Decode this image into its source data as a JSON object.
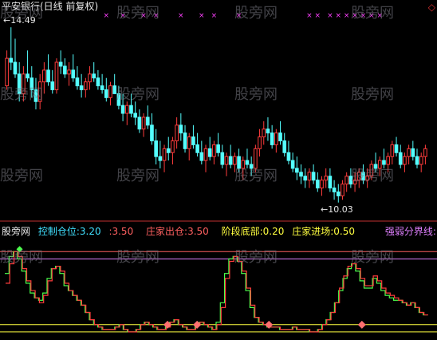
{
  "title": "平安银行(日线 前复权)",
  "watermark": "股旁网",
  "indicator_name": "股旁网",
  "colors": {
    "background": "#000000",
    "up_candle": "#ff3c3c",
    "down_candle": "#54ffff",
    "x_marker": "#ff40ff",
    "separator": "#c03030",
    "green_line": "#4cff4c",
    "red_line": "#ff3c3c",
    "yellow_line": "#ffff40",
    "purple_line": "#e080ff",
    "pink_diamond": "#ff7070"
  },
  "indicators": [
    {
      "label": "控制仓位:",
      "value": "3.20",
      "color": "#40e0ff"
    },
    {
      "label": ":",
      "value": "3.50",
      "color": "#ff6060"
    },
    {
      "label": "庄家出仓:",
      "value": "3.50",
      "color": "#ff6060"
    },
    {
      "label": "阶段底部:",
      "value": "0.20",
      "color": "#ffff40"
    },
    {
      "label": "庄家进场:",
      "value": "0.50",
      "color": "#ffff40"
    },
    {
      "label": "强弱分界线:",
      "value": "1.",
      "color": "#e080ff"
    }
  ],
  "chart_data": [
    {
      "type": "candlestick",
      "name": "price",
      "ylim": [
        9.7,
        14.9
      ],
      "annotations": [
        {
          "text": "14.49",
          "value": 14.49,
          "kind": "high"
        },
        {
          "text": "10.03",
          "value": 10.03,
          "kind": "low"
        }
      ],
      "x_markers": [
        24,
        28,
        33,
        36,
        42,
        47,
        50,
        56,
        73,
        75,
        78,
        80,
        82,
        84,
        86,
        88,
        90,
        108,
        126
      ],
      "candles": [
        [
          13.0,
          13.9,
          12.9,
          13.7
        ],
        [
          13.7,
          14.49,
          13.4,
          13.6
        ],
        [
          13.6,
          14.2,
          13.2,
          13.3
        ],
        [
          13.3,
          13.6,
          12.6,
          12.8
        ],
        [
          12.8,
          13.5,
          12.6,
          13.3
        ],
        [
          13.3,
          13.9,
          13.1,
          13.2
        ],
        [
          13.2,
          13.5,
          12.7,
          12.9
        ],
        [
          12.9,
          13.2,
          12.4,
          12.6
        ],
        [
          12.6,
          13.3,
          12.4,
          13.1
        ],
        [
          13.1,
          13.6,
          12.8,
          13.4
        ],
        [
          13.4,
          13.8,
          13.0,
          13.1
        ],
        [
          13.1,
          13.4,
          12.8,
          12.9
        ],
        [
          12.9,
          13.7,
          12.8,
          13.6
        ],
        [
          13.6,
          13.9,
          13.3,
          13.5
        ],
        [
          13.5,
          13.7,
          13.2,
          13.3
        ],
        [
          13.3,
          13.6,
          13.0,
          13.4
        ],
        [
          13.4,
          13.8,
          13.1,
          13.2
        ],
        [
          13.2,
          13.5,
          12.9,
          13.0
        ],
        [
          13.0,
          13.3,
          12.7,
          12.9
        ],
        [
          12.9,
          13.2,
          12.7,
          13.1
        ],
        [
          13.1,
          13.5,
          12.9,
          13.3
        ],
        [
          13.3,
          13.6,
          13.1,
          13.2
        ],
        [
          13.2,
          13.4,
          12.9,
          13.0
        ],
        [
          13.0,
          13.3,
          12.8,
          12.9
        ],
        [
          12.9,
          13.2,
          12.6,
          12.7
        ],
        [
          12.7,
          13.1,
          12.5,
          13.0
        ],
        [
          13.0,
          13.3,
          12.8,
          12.8
        ],
        [
          12.8,
          13.0,
          12.4,
          12.5
        ],
        [
          12.5,
          12.8,
          12.1,
          12.3
        ],
        [
          12.3,
          12.6,
          12.0,
          12.5
        ],
        [
          12.5,
          12.8,
          12.2,
          12.3
        ],
        [
          12.3,
          12.6,
          12.0,
          12.2
        ],
        [
          12.2,
          12.4,
          11.8,
          11.9
        ],
        [
          11.9,
          12.3,
          11.7,
          12.2
        ],
        [
          12.2,
          12.5,
          11.9,
          12.0
        ],
        [
          12.0,
          12.3,
          11.5,
          11.6
        ],
        [
          11.6,
          11.9,
          11.0,
          11.2
        ],
        [
          11.2,
          11.6,
          10.9,
          11.1
        ],
        [
          11.1,
          11.5,
          10.8,
          11.4
        ],
        [
          11.4,
          11.7,
          11.1,
          11.3
        ],
        [
          11.3,
          11.7,
          11.0,
          11.6
        ],
        [
          11.6,
          12.2,
          11.4,
          12.0
        ],
        [
          12.0,
          12.3,
          11.6,
          11.8
        ],
        [
          11.8,
          12.0,
          11.3,
          11.4
        ],
        [
          11.4,
          11.8,
          11.1,
          11.7
        ],
        [
          11.7,
          12.0,
          11.4,
          11.5
        ],
        [
          11.5,
          11.8,
          11.2,
          11.3
        ],
        [
          11.3,
          11.6,
          11.0,
          11.1
        ],
        [
          11.1,
          11.5,
          10.8,
          11.4
        ],
        [
          11.4,
          11.7,
          11.1,
          11.2
        ],
        [
          11.2,
          11.6,
          11.0,
          11.5
        ],
        [
          11.5,
          11.8,
          11.2,
          11.3
        ],
        [
          11.3,
          11.5,
          10.9,
          11.0
        ],
        [
          11.0,
          11.3,
          10.7,
          11.2
        ],
        [
          11.2,
          11.5,
          10.9,
          11.0
        ],
        [
          11.0,
          11.3,
          10.8,
          11.2
        ],
        [
          11.2,
          11.4,
          10.8,
          10.9
        ],
        [
          10.9,
          11.2,
          10.6,
          11.1
        ],
        [
          11.1,
          11.4,
          10.9,
          11.0
        ],
        [
          11.0,
          11.2,
          10.7,
          10.9
        ],
        [
          10.9,
          11.5,
          10.8,
          11.4
        ],
        [
          11.4,
          11.9,
          11.2,
          11.7
        ],
        [
          11.7,
          12.1,
          11.5,
          11.9
        ],
        [
          11.9,
          12.2,
          11.6,
          11.8
        ],
        [
          11.8,
          12.0,
          11.4,
          11.5
        ],
        [
          11.5,
          11.9,
          11.3,
          11.8
        ],
        [
          11.8,
          12.1,
          11.5,
          11.6
        ],
        [
          11.6,
          11.8,
          11.2,
          11.3
        ],
        [
          11.3,
          11.6,
          11.0,
          11.1
        ],
        [
          11.1,
          11.3,
          10.8,
          10.9
        ],
        [
          10.9,
          11.2,
          10.6,
          10.8
        ],
        [
          10.8,
          11.0,
          10.5,
          10.7
        ],
        [
          10.7,
          10.9,
          10.4,
          10.6
        ],
        [
          10.6,
          10.9,
          10.4,
          10.8
        ],
        [
          10.8,
          11.0,
          10.5,
          10.6
        ],
        [
          10.6,
          10.8,
          10.3,
          10.4
        ],
        [
          10.4,
          10.7,
          10.2,
          10.6
        ],
        [
          10.6,
          10.9,
          10.4,
          10.7
        ],
        [
          10.7,
          10.9,
          10.3,
          10.4
        ],
        [
          10.4,
          10.6,
          10.1,
          10.3
        ],
        [
          10.3,
          10.5,
          10.03,
          10.2
        ],
        [
          10.2,
          10.6,
          10.1,
          10.5
        ],
        [
          10.5,
          10.8,
          10.3,
          10.7
        ],
        [
          10.7,
          10.9,
          10.4,
          10.5
        ],
        [
          10.5,
          10.8,
          10.3,
          10.6
        ],
        [
          10.6,
          10.9,
          10.4,
          10.8
        ],
        [
          10.8,
          11.0,
          10.5,
          10.6
        ],
        [
          10.6,
          10.9,
          10.4,
          10.7
        ],
        [
          10.7,
          11.1,
          10.6,
          11.0
        ],
        [
          11.0,
          11.3,
          10.8,
          10.9
        ],
        [
          10.9,
          11.2,
          10.7,
          11.1
        ],
        [
          11.1,
          11.4,
          10.9,
          11.0
        ],
        [
          11.0,
          11.3,
          10.8,
          11.2
        ],
        [
          11.2,
          11.6,
          11.0,
          11.5
        ],
        [
          11.5,
          11.7,
          11.2,
          11.3
        ],
        [
          11.3,
          11.5,
          10.9,
          11.0
        ],
        [
          11.0,
          11.3,
          10.8,
          11.2
        ],
        [
          11.2,
          11.5,
          11.0,
          11.4
        ],
        [
          11.4,
          11.6,
          11.1,
          11.2
        ],
        [
          11.2,
          11.4,
          10.9,
          11.0
        ],
        [
          11.0,
          11.3,
          10.8,
          11.2
        ],
        [
          11.2,
          11.5,
          11.0,
          11.4
        ]
      ]
    },
    {
      "type": "line",
      "name": "oscillator",
      "ylim": [
        0,
        4
      ],
      "reference_lines": [
        {
          "value": 3.5,
          "color": "#ff6060"
        },
        {
          "value": 3.2,
          "color": "#e080ff"
        },
        {
          "value": 0.5,
          "color": "#ffff40"
        },
        {
          "value": 0.2,
          "color": "#ffff40"
        }
      ],
      "series": [
        {
          "values": [
            2.6,
            3.3,
            3.5,
            3.2,
            2.7,
            2.2,
            1.8,
            1.6,
            1.5,
            1.8,
            2.4,
            2.8,
            2.9,
            2.6,
            2.1,
            1.9,
            1.7,
            1.5,
            1.3,
            1.0,
            0.7,
            0.5,
            0.4,
            0.3,
            0.3,
            0.3,
            0.4,
            0.5,
            0.3,
            0.2,
            0.2,
            0.3,
            0.5,
            0.6,
            0.5,
            0.4,
            0.3,
            0.3,
            0.4,
            0.6,
            0.7,
            0.5,
            0.4,
            0.3,
            0.3,
            0.5,
            0.6,
            0.5,
            0.4,
            0.3,
            0.6,
            1.4,
            2.6,
            3.2,
            3.3,
            3.1,
            2.6,
            1.9,
            1.2,
            0.8,
            0.6,
            0.5,
            0.4,
            0.4,
            0.4,
            0.3,
            0.3,
            0.3,
            0.4,
            0.3,
            0.3,
            0.3,
            0.2,
            0.2,
            0.3,
            0.5,
            0.7,
            1.0,
            1.4,
            1.9,
            2.4,
            2.8,
            3.0,
            2.7,
            2.3,
            2.0,
            2.0,
            2.4,
            2.2,
            1.9,
            1.7,
            1.6,
            1.5,
            1.5,
            1.4,
            1.3,
            1.4,
            1.2,
            1.0,
            0.9
          ],
          "color": "#4cff4c"
        },
        {
          "values": [
            2.2,
            3.0,
            3.5,
            3.3,
            2.8,
            2.3,
            1.9,
            1.6,
            1.4,
            1.7,
            2.3,
            2.8,
            2.9,
            2.7,
            2.2,
            1.9,
            1.7,
            1.5,
            1.3,
            1.0,
            0.7,
            0.5,
            0.4,
            0.3,
            0.3,
            0.3,
            0.4,
            0.5,
            0.3,
            0.2,
            0.2,
            0.3,
            0.5,
            0.6,
            0.5,
            0.4,
            0.3,
            0.3,
            0.4,
            0.6,
            0.7,
            0.5,
            0.4,
            0.3,
            0.3,
            0.5,
            0.6,
            0.5,
            0.4,
            0.3,
            0.5,
            1.2,
            2.4,
            3.1,
            3.3,
            3.1,
            2.7,
            2.0,
            1.3,
            0.8,
            0.6,
            0.5,
            0.4,
            0.4,
            0.4,
            0.3,
            0.3,
            0.3,
            0.4,
            0.3,
            0.3,
            0.3,
            0.2,
            0.2,
            0.3,
            0.5,
            0.7,
            1.0,
            1.4,
            2.0,
            2.5,
            2.9,
            3.0,
            2.8,
            2.4,
            2.1,
            2.1,
            2.5,
            2.3,
            2.0,
            1.8,
            1.7,
            1.6,
            1.5,
            1.4,
            1.3,
            1.4,
            1.2,
            1.0,
            0.9
          ],
          "color": "#ff3c3c"
        }
      ],
      "signal_markers": [
        38,
        45,
        62,
        84
      ],
      "top_marker": 3
    }
  ]
}
